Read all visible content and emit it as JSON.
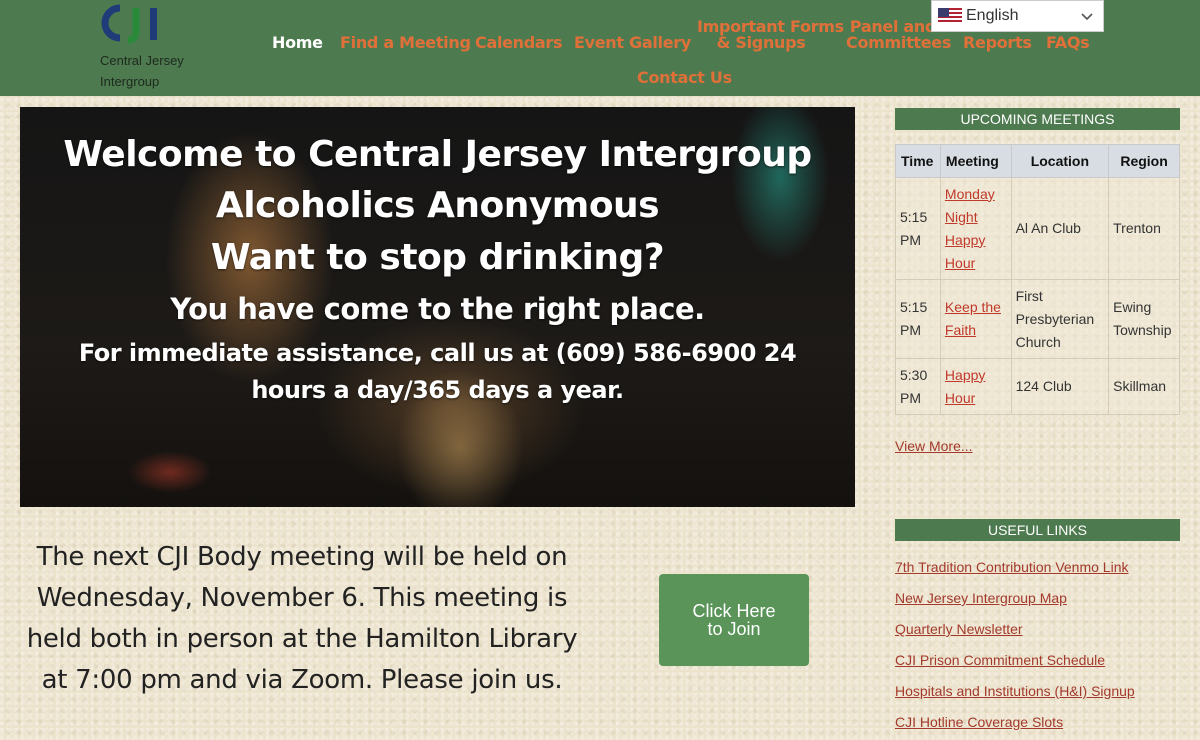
{
  "header": {
    "logo_text_line1": "Central Jersey",
    "logo_text_line2": "Intergroup",
    "nav": [
      {
        "label": "Home"
      },
      {
        "label": "Find a Meeting"
      },
      {
        "label": "Calendars"
      },
      {
        "label": "Event Gallery"
      },
      {
        "label_line1": "Important Forms",
        "label_line2": "& Signups"
      },
      {
        "label_line1": "Panel and",
        "label_line2": "Committees"
      },
      {
        "label": "Reports"
      },
      {
        "label": "FAQs"
      },
      {
        "label": "Contact Us"
      }
    ],
    "language": {
      "selected": "English",
      "icon": "us-flag-icon"
    }
  },
  "hero": {
    "line1": "Welcome to Central Jersey Intergroup",
    "line2": "Alcoholics Anonymous",
    "line3": "Want to stop drinking?",
    "line4": "You have come to the right place.",
    "line5": "For immediate assistance, call us at (609) 586-6900 24 hours a day/365 days a year."
  },
  "announcement": {
    "text": "The next CJI Body meeting will be held on Wednesday, November 6. This meeting is held both in person at the Hamilton Library at 7:00 pm and via Zoom. Please join us.",
    "button_label": "Click Here to Join"
  },
  "upcoming": {
    "heading": "UPCOMING MEETINGS",
    "columns": [
      "Time",
      "Meeting",
      "Location",
      "Region"
    ],
    "rows": [
      {
        "time": "5:15 PM",
        "meeting": "Monday Night Happy Hour",
        "location": "Al An Club",
        "region": "Trenton"
      },
      {
        "time": "5:15 PM",
        "meeting": "Keep the Faith",
        "location": "First Presbyterian Church",
        "region": "Ewing Township"
      },
      {
        "time": "5:30 PM",
        "meeting": "Happy Hour",
        "location": "124 Club",
        "region": "Skillman"
      }
    ],
    "view_more": "View More..."
  },
  "useful_links": {
    "heading": "USEFUL LINKS",
    "items": [
      "7th Tradition Contribution Venmo Link",
      "New Jersey Intergroup Map",
      "Quarterly Newsletter",
      "CJI Prison Commitment Schedule",
      "Hospitals and Institutions (H&I) Signup",
      "CJI Hotline Coverage Slots"
    ]
  },
  "colors": {
    "header_bg": "#4e7a4f",
    "nav_link": "#e0703a",
    "button_bg": "#5a9459",
    "link": "#a33a2c"
  }
}
